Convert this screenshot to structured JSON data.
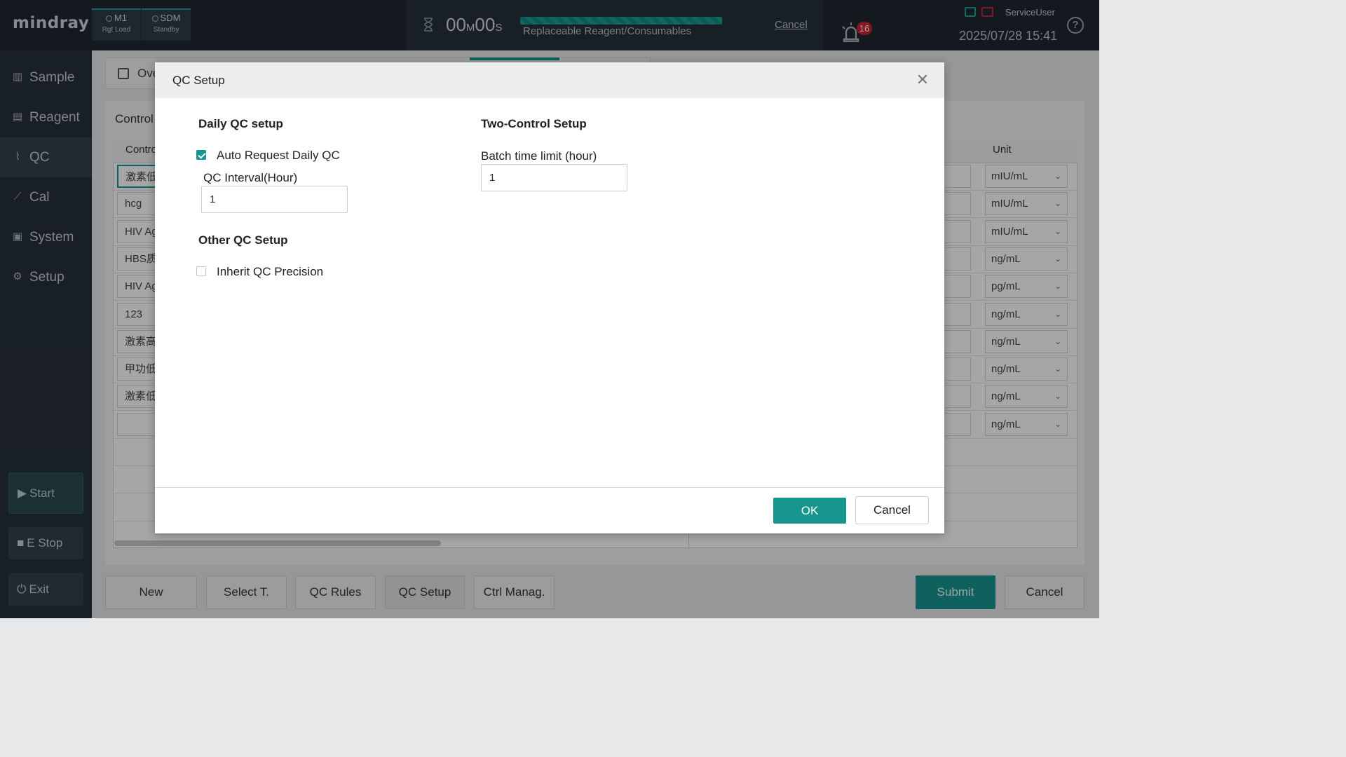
{
  "app": {
    "logo": "mindray",
    "modules": [
      {
        "name": "M1",
        "state": "Rgt Load"
      },
      {
        "name": "SDM",
        "state": "Standby"
      }
    ],
    "timer": {
      "minutes": "00",
      "minutes_unit": "M",
      "seconds": "00",
      "seconds_unit": "S"
    },
    "progress": {
      "label": "Replaceable Reagent/Consumables",
      "fraction": 1.0
    },
    "top_cancel": "Cancel",
    "alarm_count": "16",
    "user": "ServiceUser",
    "datetime": "2025/07/28 15:41",
    "help": "?"
  },
  "sidebar": {
    "items": [
      {
        "label": "Sample",
        "icon": "sample-icon"
      },
      {
        "label": "Reagent",
        "icon": "reagent-icon"
      },
      {
        "label": "QC",
        "icon": "qc-icon",
        "active": true
      },
      {
        "label": "Cal",
        "icon": "cal-icon"
      },
      {
        "label": "System",
        "icon": "system-icon"
      },
      {
        "label": "Setup",
        "icon": "setup-icon"
      }
    ],
    "start": "Start",
    "estop": "E Stop",
    "exit": "Exit"
  },
  "background": {
    "tab_label": "Ove",
    "control_label": "Control",
    "table_header_control": "Contro",
    "table_header_unit": "Unit",
    "rows": [
      {
        "control": "激素低",
        "unit": "mIU/mL"
      },
      {
        "control": "hcg",
        "unit": "mIU/mL"
      },
      {
        "control": "HIV Ag",
        "unit": "mIU/mL"
      },
      {
        "control": "HBS质",
        "unit": "ng/mL"
      },
      {
        "control": "HIV Ag",
        "unit": "pg/mL"
      },
      {
        "control": "123",
        "unit": "ng/mL"
      },
      {
        "control": "激素高",
        "unit": "ng/mL"
      },
      {
        "control": "甲功低",
        "unit": "ng/mL"
      },
      {
        "control": "激素低",
        "unit": "ng/mL"
      },
      {
        "control": "",
        "unit": "ng/mL"
      }
    ],
    "bottom_buttons": {
      "new": "New",
      "select": "Select T.",
      "qc_rules": "QC Rules",
      "qc_setup": "QC  Setup",
      "ctrl_manag": "Ctrl Manag.",
      "submit": "Submit",
      "cancel": "Cancel"
    }
  },
  "modal": {
    "title": "QC Setup",
    "daily": {
      "title": "Daily QC setup",
      "auto_request_label": "Auto Request Daily QC",
      "auto_request_checked": true,
      "interval_label": "QC Interval(Hour)",
      "interval_value": "1"
    },
    "other": {
      "title": "Other QC Setup",
      "inherit_label": "Inherit QC Precision",
      "inherit_checked": false
    },
    "two_control": {
      "title": "Two-Control Setup",
      "batch_label": "Batch time limit (hour)",
      "batch_value": "1"
    },
    "ok": "OK",
    "cancel": "Cancel"
  },
  "colors": {
    "accent": "#17968f",
    "topbar": "#1f2730",
    "sidebar": "#263039",
    "alarm": "#c9232f"
  }
}
